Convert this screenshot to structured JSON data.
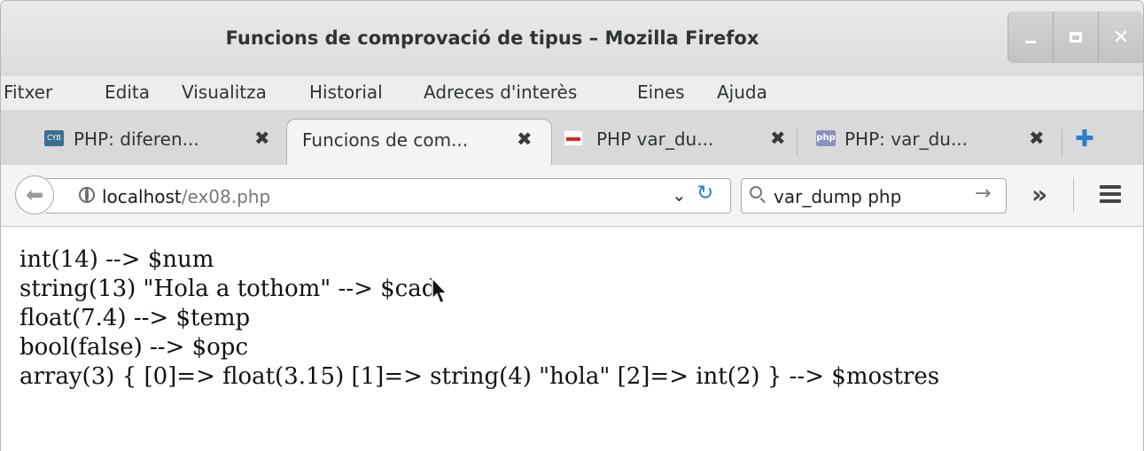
{
  "window": {
    "title": "Funcions de comprovació de tipus – Mozilla Firefox"
  },
  "menubar": {
    "items": [
      "Fitxer",
      "Edita",
      "Visualitza",
      "Historial",
      "Adreces d'interès",
      "Eines",
      "Ajuda"
    ]
  },
  "tabs": [
    {
      "label": "PHP: diferen...",
      "favicon": "cyb-icon",
      "active": false
    },
    {
      "label": "Funcions de com...",
      "favicon": "none",
      "active": true
    },
    {
      "label": "PHP var_du...",
      "favicon": "site-icon",
      "active": false
    },
    {
      "label": "PHP: var_du...",
      "favicon": "php-icon",
      "active": false
    }
  ],
  "navbar": {
    "url_host": "localhost",
    "url_path": "/ex08.php",
    "search_value": "var_dump php"
  },
  "content": {
    "lines": [
      "int(14) --> $num",
      "string(13) \"Hola a tothom\" --> $cad",
      "float(7.4) --> $temp",
      "bool(false) --> $opc",
      "array(3) { [0]=> float(3.15) [1]=> string(4) \"hola\" [2]=> int(2) } --> $mostres"
    ]
  },
  "colors": {
    "accent": "#2c7fcc",
    "titlebar": "#dcdcdc",
    "tab_active": "#f4f4f4"
  }
}
